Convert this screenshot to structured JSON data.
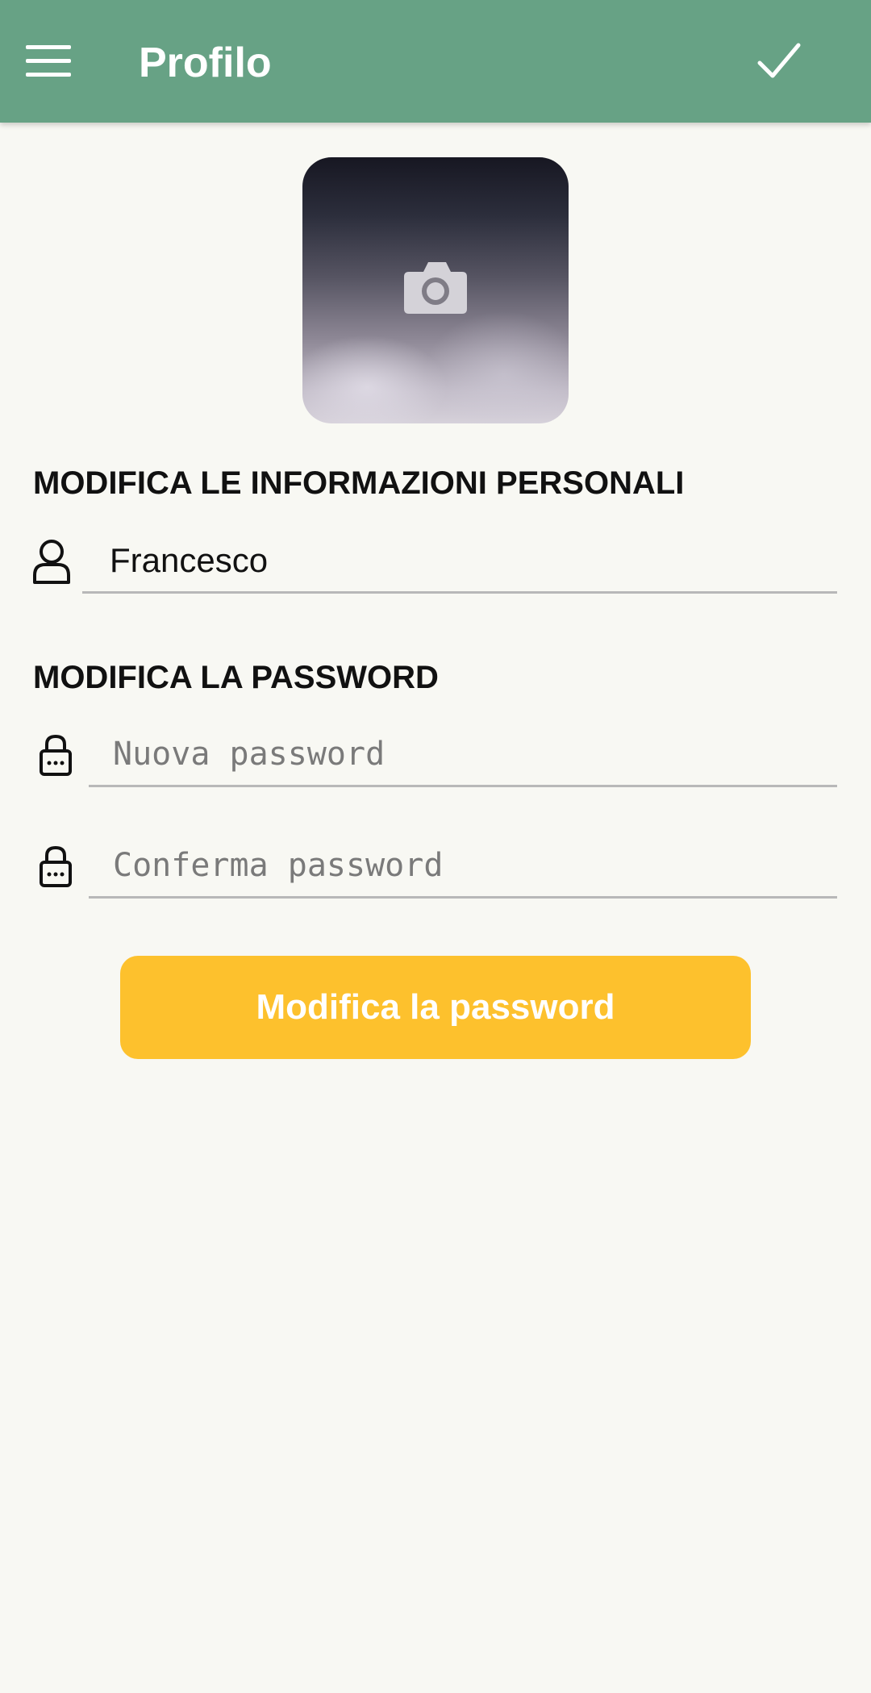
{
  "app_bar": {
    "title": "Profilo",
    "menu_icon": "hamburger-menu-icon",
    "confirm_icon": "checkmark-icon",
    "background_color": "#67a285"
  },
  "avatar": {
    "icon": "camera-icon"
  },
  "personal_info": {
    "section_title": "MODIFICA LE INFORMAZIONI PERSONALI",
    "name_icon": "user-icon",
    "name_value": "Francesco"
  },
  "password": {
    "section_title": "MODIFICA LA PASSWORD",
    "new_password_icon": "lock-icon",
    "new_password_placeholder": "Nuova password",
    "new_password_value": "",
    "confirm_password_icon": "lock-icon",
    "confirm_password_placeholder": "Conferma password",
    "confirm_password_value": "",
    "submit_label": "Modifica la password",
    "submit_color": "#fdc12d"
  },
  "colors": {
    "background": "#f8f8f3",
    "divider": "#b8b8b8"
  }
}
